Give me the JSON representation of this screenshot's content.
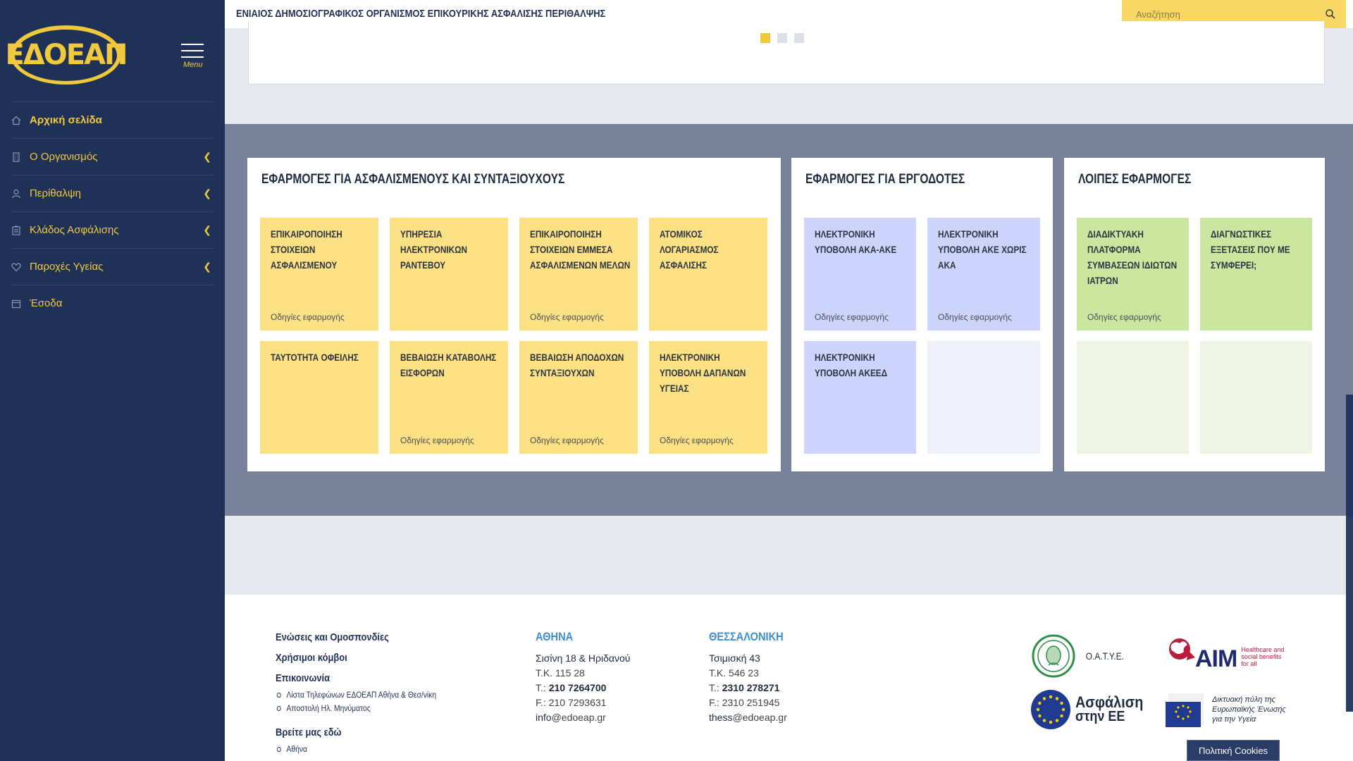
{
  "logo": {
    "text": "ΕΔΟΕΑΠ"
  },
  "menu_toggle": {
    "label": "Menu"
  },
  "sidebar": {
    "items": [
      {
        "label": "Αρχική σελίδα",
        "icon": "home-icon"
      },
      {
        "label": "Ο Οργανισμός",
        "icon": "building-icon"
      },
      {
        "label": "Περίθαλψη",
        "icon": "user-icon"
      },
      {
        "label": "Κλάδος Ασφάλισης",
        "icon": "clipboard-icon"
      },
      {
        "label": "Παροχές Υγείας",
        "icon": "heart-icon"
      },
      {
        "label": "Έσοδα",
        "icon": "calendar-icon"
      }
    ]
  },
  "header": {
    "title": "ΕΝΙΑΙΟΣ ΔΗΜΟΣΙΟΓΡΑΦΙΚΟΣ ΟΡΓΑΝΙΣΜΟΣ ΕΠΙΚΟΥΡΙΚΗΣ ΑΣΦΑΛΙΣΗΣ ΠΕΡΙΘΑΛΨΗΣ",
    "search_placeholder": "Αναζήτηση"
  },
  "panels": {
    "insured": {
      "title": "ΕΦΑΡΜΟΓΕΣ ΓΙΑ ΑΣΦΑΛΙΣΜΕΝΟΥΣ ΚΑΙ ΣΥΝΤΑΞΙΟΥΧΟΥΣ",
      "tiles": [
        {
          "title": "ΕΠΙΚΑΙΡΟΠΟΙΗΣΗ ΣΤΟΙΧΕΙΩΝ ΑΣΦΑΛΙΣΜΕΝΟΥ",
          "link": "Οδηγίες εφαρμογής"
        },
        {
          "title": "ΥΠΗΡΕΣΙΑ ΗΛΕΚΤΡΟΝΙΚΩΝ ΡΑΝΤΕΒΟΥ",
          "link": ""
        },
        {
          "title": "ΕΠΙΚΑΙΡΟΠΟΙΗΣΗ ΣΤΟΙΧΕΙΩΝ ΕΜΜΕΣΑ ΑΣΦΑΛΙΣΜΕΝΩΝ ΜΕΛΩΝ",
          "link": "Οδηγίες εφαρμογής"
        },
        {
          "title": "ΑΤΟΜΙΚΟΣ ΛΟΓΑΡΙΑΣΜΟΣ ΑΣΦΑΛΙΣΗΣ",
          "link": ""
        },
        {
          "title": "ΤΑΥΤΟΤΗΤΑ ΟΦΕΙΛΗΣ",
          "link": ""
        },
        {
          "title": "ΒΕΒΑΙΩΣΗ ΚΑΤΑΒΟΛΗΣ ΕΙΣΦΟΡΩΝ",
          "link": "Οδηγίες εφαρμογής"
        },
        {
          "title": "ΒΕΒΑΙΩΣΗ ΑΠΟΔΟΧΩΝ ΣΥΝΤΑΞΙΟΥΧΩΝ",
          "link": "Οδηγίες εφαρμογής"
        },
        {
          "title": "ΗΛΕΚΤΡΟΝΙΚΗ ΥΠΟΒΟΛΗ ΔΑΠΑΝΩΝ ΥΓΕΙΑΣ",
          "link": "Οδηγίες εφαρμογής"
        }
      ]
    },
    "employers": {
      "title": "ΕΦΑΡΜΟΓΕΣ ΓΙΑ ΕΡΓΟΔΟΤΕΣ",
      "tiles": [
        {
          "title": "ΗΛΕΚΤΡΟΝΙΚΗ ΥΠΟΒΟΛΗ ΑΚΑ-ΑΚΕ",
          "link": "Οδηγίες εφαρμογής"
        },
        {
          "title": "ΗΛΕΚΤΡΟΝΙΚΗ ΥΠΟΒΟΛΗ ΑΚΕ ΧΩΡΙΣ ΑΚΑ",
          "link": "Οδηγίες εφαρμογής"
        },
        {
          "title": "ΗΛΕΚΤΡΟΝΙΚΗ ΥΠΟΒΟΛΗ ΑΚΕΕΔ",
          "link": ""
        }
      ]
    },
    "other": {
      "title": "ΛΟΙΠΕΣ ΕΦΑΡΜΟΓΕΣ",
      "tiles": [
        {
          "title": "ΔΙΑΔΙΚΤΥΑΚΗ ΠΛΑΤΦΟΡΜΑ ΣΥΜΒΑΣΕΩΝ ΙΔΙΩΤΩΝ ΙΑΤΡΩΝ",
          "link": "Οδηγίες εφαρμογής"
        },
        {
          "title": "ΔΙΑΓΝΩΣΤΙΚΕΣ ΕΞΕΤΑΣΕΙΣ ΠΟΥ ΜΕ ΣΥΜΦΕΡΕΙ;",
          "link": ""
        }
      ]
    }
  },
  "footer": {
    "links": {
      "unions": "Ενώσεις και Ομοσπονδίες",
      "useful_nodes": "Χρήσιμοι κόμβοι",
      "contact": "Επικοινωνία",
      "contact_items": [
        "Λίστα Τηλεφώνων ΕΔΟΕΑΠ Αθήνα & Θεσ/νίκη",
        "Αποστολή Ηλ. Μηνύματος"
      ],
      "find_us": "Βρείτε μας εδώ",
      "find_us_items": [
        "Αθήνα"
      ]
    },
    "athens": {
      "city": "ΑΘΗΝΑ",
      "address": "Σισίνη 18 & Ηριδανού",
      "tk_prefix": "Τ.Κ. ",
      "tk": "115 28",
      "tel_prefix": "Τ.: ",
      "tel": "210 7264700",
      "fax_prefix": "F.: ",
      "fax": "210 7293631",
      "email_user": "info",
      "email_domain": "@edoeap.gr"
    },
    "thessaloniki": {
      "city": "ΘΕΣΣΑΛΟΝΙΚΗ",
      "address": "Τσιμισκή 43",
      "tk_prefix": "Τ.Κ. ",
      "tk": "546 23",
      "tel_prefix": "Τ.: ",
      "tel": "2310 278271",
      "fax_prefix": "F.: ",
      "fax": "2310 251945",
      "email_user": "thess",
      "email_domain": "@edoeap.gr"
    },
    "partners": {
      "oatye": "Ο.Α.Τ.Υ.Ε.",
      "aim": "AIM",
      "aim_tagline_1": "Healthcare and",
      "aim_tagline_2": "social benefits",
      "aim_tagline_3": "for all",
      "eu_insurance_1": "Ασφάλιση",
      "eu_insurance_2": "στην ΕΕ",
      "eu_health_1": "Δικτυακή πύλη της",
      "eu_health_2": "Ευρωπαϊκής Ένωσης",
      "eu_health_3": "για την Υγεία"
    },
    "cookies_label": "Πολιτική Cookies"
  },
  "colors": {
    "sidebar_bg": "#1f3157",
    "accent_yellow": "#f0ca3c",
    "tile_yellow": "#fbe183",
    "tile_blue": "#cdd4fb",
    "tile_green": "#cbe69e",
    "band_gray": "#78839b",
    "footer_city": "#3e8ed0"
  }
}
